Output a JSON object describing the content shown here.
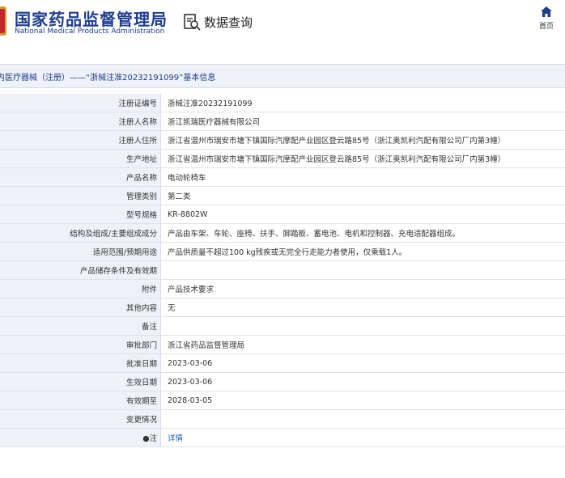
{
  "header": {
    "org_name_cn": "国家药品监督管理局",
    "org_name_en": "National Medical Products Administration",
    "query_title": "数据查询",
    "home_label": "首页"
  },
  "section": {
    "title": "内医疗器械（注册）——“浙械注准20232191099”基本信息"
  },
  "rows": [
    {
      "label": "注册证编号",
      "value": "浙械注准20232191099"
    },
    {
      "label": "注册人名称",
      "value": "浙江凯瑞医疗器械有限公司"
    },
    {
      "label": "注册人住所",
      "value": "浙江省温州市瑞安市塘下镇国际汽摩配产业园区登云路85号（浙江奥凯利汽配有限公司厂内第3幢）"
    },
    {
      "label": "生产地址",
      "value": "浙江省温州市瑞安市塘下镇国际汽摩配产业园区登云路85号（浙江奥凯利汽配有限公司厂内第3幢）"
    },
    {
      "label": "产品名称",
      "value": "电动轮椅车"
    },
    {
      "label": "管理类别",
      "value": "第二类"
    },
    {
      "label": "型号规格",
      "value": "KR-8802W"
    },
    {
      "label": "结构及组成/主要组成成分",
      "value": "产品由车架、车轮、座椅、扶手、脚踏板、蓄电池、电机和控制器、充电适配器组成。"
    },
    {
      "label": "适用范围/预期用途",
      "value": "产品供质量不超过100 kg残疾或无完全行走能力者使用，仅乘载1人。"
    },
    {
      "label": "产品储存条件及有效期",
      "value": ""
    },
    {
      "label": "附件",
      "value": "产品技术要求"
    },
    {
      "label": "其他内容",
      "value": "无"
    },
    {
      "label": "备注",
      "value": ""
    },
    {
      "label": "审批部门",
      "value": "浙江省药品监督管理局"
    },
    {
      "label": "批准日期",
      "value": "2023-03-06"
    },
    {
      "label": "生效日期",
      "value": "2023-03-06"
    },
    {
      "label": "有效期至",
      "value": "2028-03-05"
    },
    {
      "label": "变更情况",
      "value": ""
    }
  ],
  "note": {
    "label": "●注",
    "link_text": "详情"
  },
  "colors": {
    "brand": "#1f3c8f",
    "label_bg": "#eef1f7",
    "link": "#1f5fb5"
  },
  "icons": {
    "emblem": "emblem-icon",
    "query": "search-document-icon",
    "home": "home-icon"
  }
}
